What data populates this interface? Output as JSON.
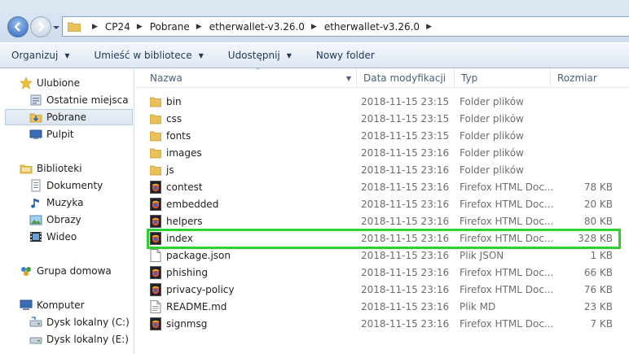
{
  "address": {
    "crumbs": [
      "CP24",
      "Pobrane",
      "etherwallet-v3.26.0",
      "etherwallet-v3.26.0"
    ]
  },
  "toolbar": {
    "organize": "Organizuj",
    "include_library": "Umieść w bibliotece",
    "share": "Udostępnij",
    "new_folder": "Nowy folder"
  },
  "nav": {
    "favorites": "Ulubione",
    "recent": "Ostatnie miejsca",
    "downloads": "Pobrane",
    "desktop": "Pulpit",
    "libraries": "Biblioteki",
    "documents": "Dokumenty",
    "music": "Muzyka",
    "pictures": "Obrazy",
    "videos": "Wideo",
    "homegroup": "Grupa domowa",
    "computer": "Komputer",
    "drive_c": "Dysk lokalny (C:)",
    "drive_e": "Dysk lokalny (E:)"
  },
  "columns": {
    "name": "Nazwa",
    "date": "Data modyfikacji",
    "type": "Typ",
    "size": "Rozmiar"
  },
  "files": [
    {
      "name": "bin",
      "date": "2018-11-15 23:15",
      "type": "Folder plików",
      "size": "",
      "icon": "folder-icon"
    },
    {
      "name": "css",
      "date": "2018-11-15 23:15",
      "type": "Folder plików",
      "size": "",
      "icon": "folder-icon"
    },
    {
      "name": "fonts",
      "date": "2018-11-15 23:15",
      "type": "Folder plików",
      "size": "",
      "icon": "folder-icon"
    },
    {
      "name": "images",
      "date": "2018-11-15 23:16",
      "type": "Folder plików",
      "size": "",
      "icon": "folder-icon"
    },
    {
      "name": "js",
      "date": "2018-11-15 23:16",
      "type": "Folder plików",
      "size": "",
      "icon": "folder-icon"
    },
    {
      "name": "contest",
      "date": "2018-11-15 23:16",
      "type": "Firefox HTML Doc...",
      "size": "78 KB",
      "icon": "firefox-html-icon"
    },
    {
      "name": "embedded",
      "date": "2018-11-15 23:16",
      "type": "Firefox HTML Doc...",
      "size": "20 KB",
      "icon": "firefox-html-icon"
    },
    {
      "name": "helpers",
      "date": "2018-11-15 23:16",
      "type": "Firefox HTML Doc...",
      "size": "80 KB",
      "icon": "firefox-html-icon"
    },
    {
      "name": "index",
      "date": "2018-11-15 23:16",
      "type": "Firefox HTML Doc...",
      "size": "328 KB",
      "icon": "firefox-html-icon"
    },
    {
      "name": "package.json",
      "date": "2018-11-15 23:16",
      "type": "Plik JSON",
      "size": "1 KB",
      "icon": "blank-file-icon"
    },
    {
      "name": "phishing",
      "date": "2018-11-15 23:16",
      "type": "Firefox HTML Doc...",
      "size": "66 KB",
      "icon": "firefox-html-icon"
    },
    {
      "name": "privacy-policy",
      "date": "2018-11-15 23:16",
      "type": "Firefox HTML Doc...",
      "size": "76 KB",
      "icon": "firefox-html-icon"
    },
    {
      "name": "README.md",
      "date": "2018-11-15 23:16",
      "type": "Plik MD",
      "size": "23 KB",
      "icon": "text-file-icon"
    },
    {
      "name": "signmsg",
      "date": "2018-11-15 23:16",
      "type": "Firefox HTML Doc...",
      "size": "7 KB",
      "icon": "firefox-html-icon"
    }
  ],
  "colors": {
    "highlight": "#2ed02e",
    "folder": "#e8c15a",
    "accent": "#2c63b8"
  }
}
